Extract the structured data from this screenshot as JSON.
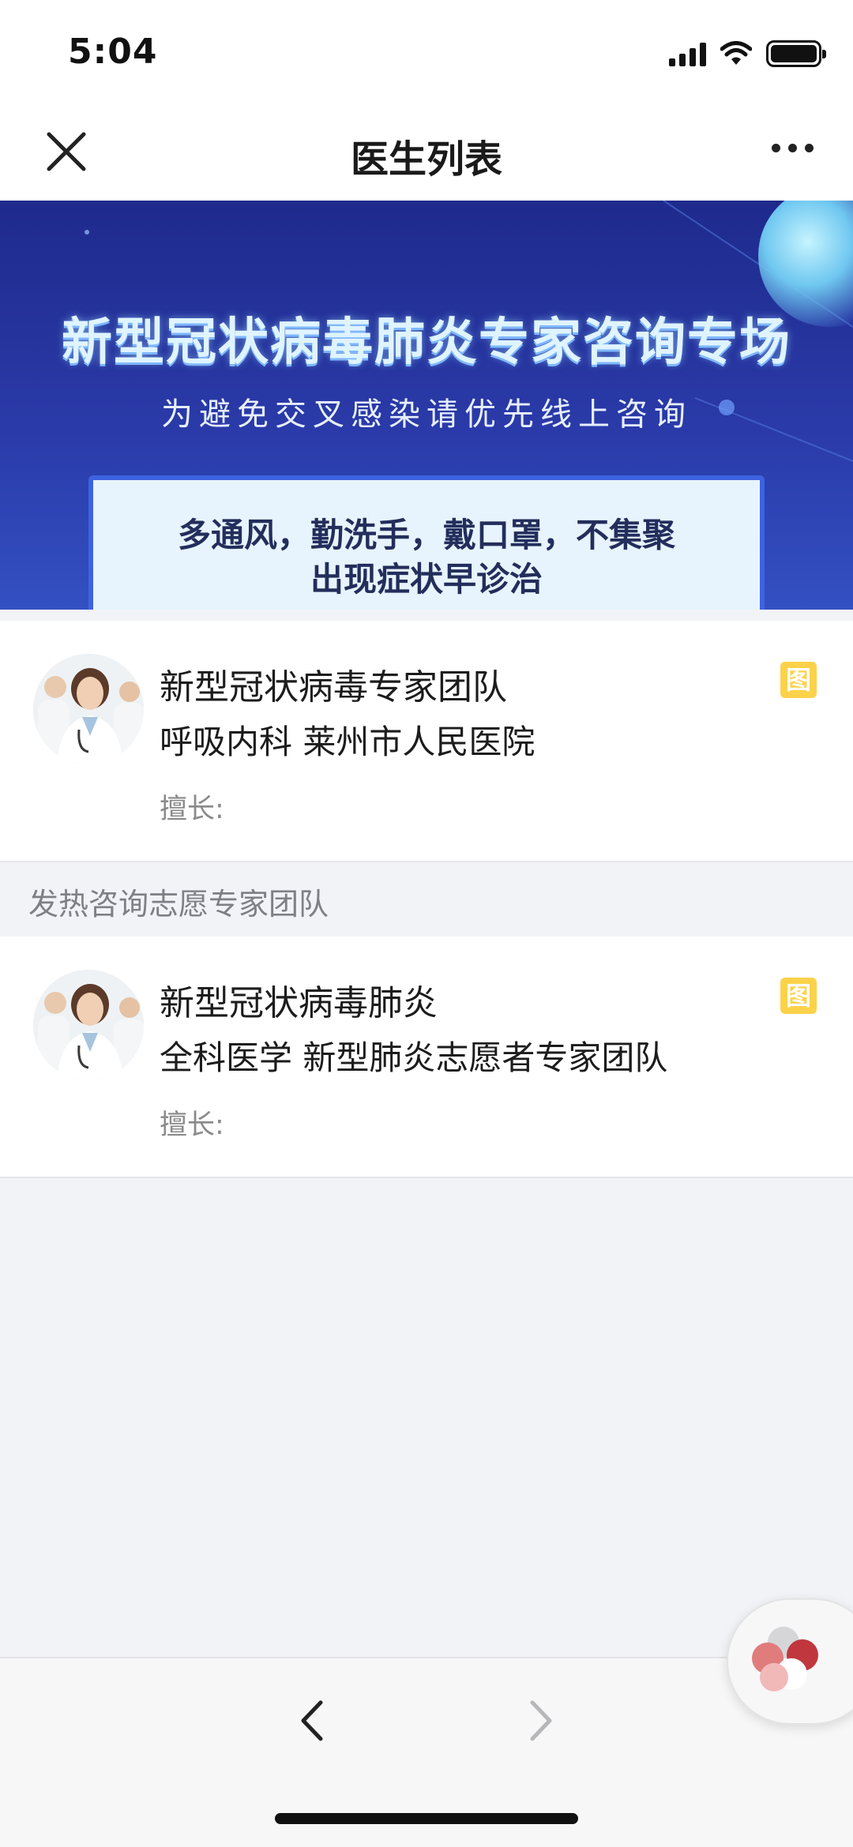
{
  "status_bar": {
    "time": "5:04"
  },
  "nav": {
    "title": "医生列表",
    "close_icon": "close-icon",
    "more_icon": "more-icon"
  },
  "banner": {
    "title": "新型冠状病毒肺炎专家咨询专场",
    "subtitle": "为避免交叉感染请优先线上咨询",
    "tips_line1": "多通风，勤洗手，戴口罩，不集聚",
    "tips_line2": "出现症状早诊治"
  },
  "doctors": [
    {
      "name": "新型冠状病毒专家团队",
      "department": "呼吸内科 莱州市人民医院",
      "skill_label": "擅长:",
      "badge": "图"
    },
    {
      "name": "新型冠状病毒肺炎",
      "department": "全科医学 新型肺炎志愿者专家团队",
      "skill_label": "擅长:",
      "badge": "图"
    }
  ],
  "section_header": "发热咨询志愿专家团队",
  "bottom_bar": {
    "back_icon": "chevron-left-icon",
    "forward_icon": "chevron-right-icon"
  },
  "colors": {
    "banner_bg": "#2a3aa8",
    "badge": "#fbd24a",
    "page_bg": "#f2f3f7"
  }
}
